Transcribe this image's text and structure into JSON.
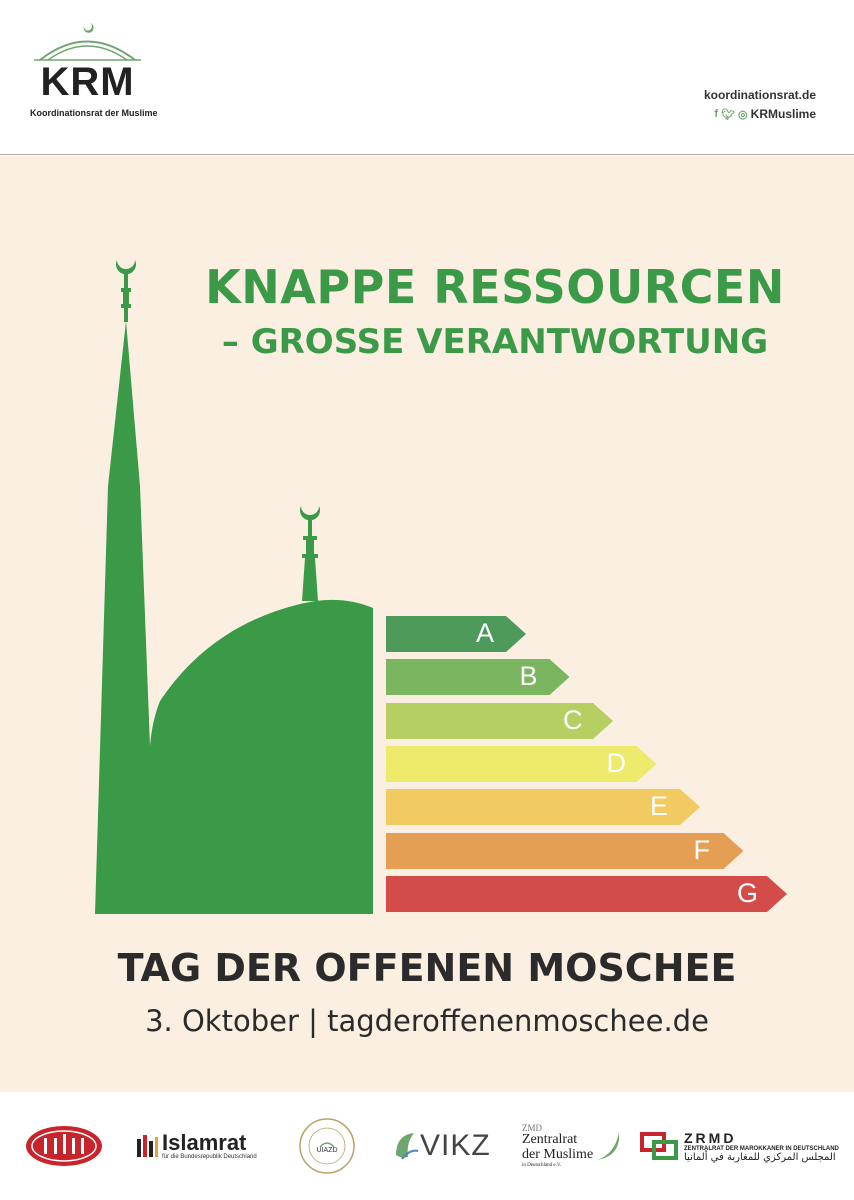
{
  "header": {
    "brand_acronym": "KRM",
    "brand_name": "Koordinationsrat der Muslime",
    "website": "koordinationsrat.de",
    "social_handle": "KRMuslime",
    "social_icons": [
      "facebook-icon",
      "twitter-icon",
      "instagram-icon"
    ]
  },
  "poster": {
    "headline_line1": "KNAPPE RESSOURCEN",
    "headline_line2": "– GROSSE VERANTWORTUNG",
    "energy_scale": [
      {
        "label": "A",
        "color": "#4e9a5a"
      },
      {
        "label": "B",
        "color": "#7ab65f"
      },
      {
        "label": "C",
        "color": "#b6cf62"
      },
      {
        "label": "D",
        "color": "#eeea6b"
      },
      {
        "label": "E",
        "color": "#f1cb62"
      },
      {
        "label": "F",
        "color": "#e59f54"
      },
      {
        "label": "G",
        "color": "#d44c4a"
      }
    ],
    "event_title": "TAG DER OFFENEN MOSCHEE",
    "event_date_line": "3. Oktober | tagderoffenenmoschee.de"
  },
  "footer": {
    "partners": [
      {
        "name": "ditib-logo"
      },
      {
        "name": "Islamrat",
        "subtitle": "für die Bundesrepublik Deutschland"
      },
      {
        "name": "UIAZD"
      },
      {
        "name": "VIKZ"
      },
      {
        "name": "ZMD",
        "line1": "Zentralrat",
        "line2": "der Muslime",
        "line3": "in Deutschland e.V."
      },
      {
        "name": "ZRMD",
        "subtitle": "ZENTRALRAT DER MAROKKANER IN DEUTSCHLAND",
        "arabic": "المجلس المركزي للمغاربة في ألمانيا"
      }
    ]
  },
  "colors": {
    "green": "#3a9a47",
    "poster_bg": "#fbefe2",
    "dark_text": "#2b2b2b"
  }
}
